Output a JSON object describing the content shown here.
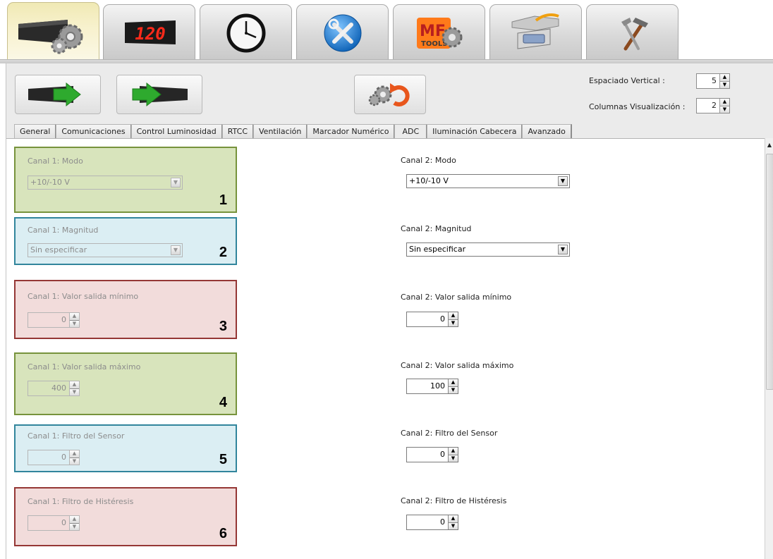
{
  "top_tabs": [
    {
      "icon": "display-settings-icon"
    },
    {
      "icon": "led-counter-icon",
      "display_text": "120"
    },
    {
      "icon": "clock-icon"
    },
    {
      "icon": "tools-icon"
    },
    {
      "icon": "mf-tools-icon",
      "display_text": "MF TOOLS"
    },
    {
      "icon": "cable-connector-icon"
    },
    {
      "icon": "hammer-icon"
    }
  ],
  "toolbar": {
    "send_icon": "send-to-display-icon",
    "receive_icon": "receive-icon",
    "reset_icon": "reset-settings-icon"
  },
  "spacing": {
    "label": "Espaciado Vertical :",
    "value": "5"
  },
  "columns": {
    "label": "Columnas Visualización :",
    "value": "2"
  },
  "tabs": [
    {
      "label": "General"
    },
    {
      "label": "Comunicaciones"
    },
    {
      "label": "Control Luminosidad"
    },
    {
      "label": "RTCC"
    },
    {
      "label": "Ventilación"
    },
    {
      "label": "Marcador Numérico"
    },
    {
      "label": "ADC",
      "active": true
    },
    {
      "label": "Iluminación Cabecera"
    },
    {
      "label": "Avanzado"
    }
  ],
  "canal1": {
    "modo": {
      "label": "Canal 1: Modo",
      "value": "+10/-10 V",
      "number": "1"
    },
    "magnitud": {
      "label": "Canal 1: Magnitud",
      "value": "Sin especificar",
      "number": "2"
    },
    "min": {
      "label": "Canal 1: Valor salida mínimo",
      "value": "0",
      "number": "3"
    },
    "max": {
      "label": "Canal 1: Valor salida máximo",
      "value": "400",
      "number": "4"
    },
    "filtro": {
      "label": "Canal 1: Filtro del Sensor",
      "value": "0",
      "number": "5"
    },
    "histeresis": {
      "label": "Canal 1: Filtro de Histéresis",
      "value": "0",
      "number": "6"
    }
  },
  "canal2": {
    "modo": {
      "label": "Canal 2: Modo",
      "value": "+10/-10 V"
    },
    "magnitud": {
      "label": "Canal 2: Magnitud",
      "value": "Sin especificar"
    },
    "min": {
      "label": "Canal 2: Valor salida mínimo",
      "value": "0"
    },
    "max": {
      "label": "Canal 2: Valor salida máximo",
      "value": "100"
    },
    "filtro": {
      "label": "Canal 2: Filtro del Sensor",
      "value": "0"
    },
    "histeresis": {
      "label": "Canal 2: Filtro de Histéresis",
      "value": "0"
    }
  },
  "colors": {
    "green_bg": "#d8e4bc",
    "green_border": "#77933c",
    "blue_bg": "#dbeef3",
    "blue_border": "#31859c",
    "red_bg": "#f2dcdb",
    "red_border": "#953735",
    "arrow_green": "#2eaa2e",
    "reset_orange": "#e8561c"
  }
}
